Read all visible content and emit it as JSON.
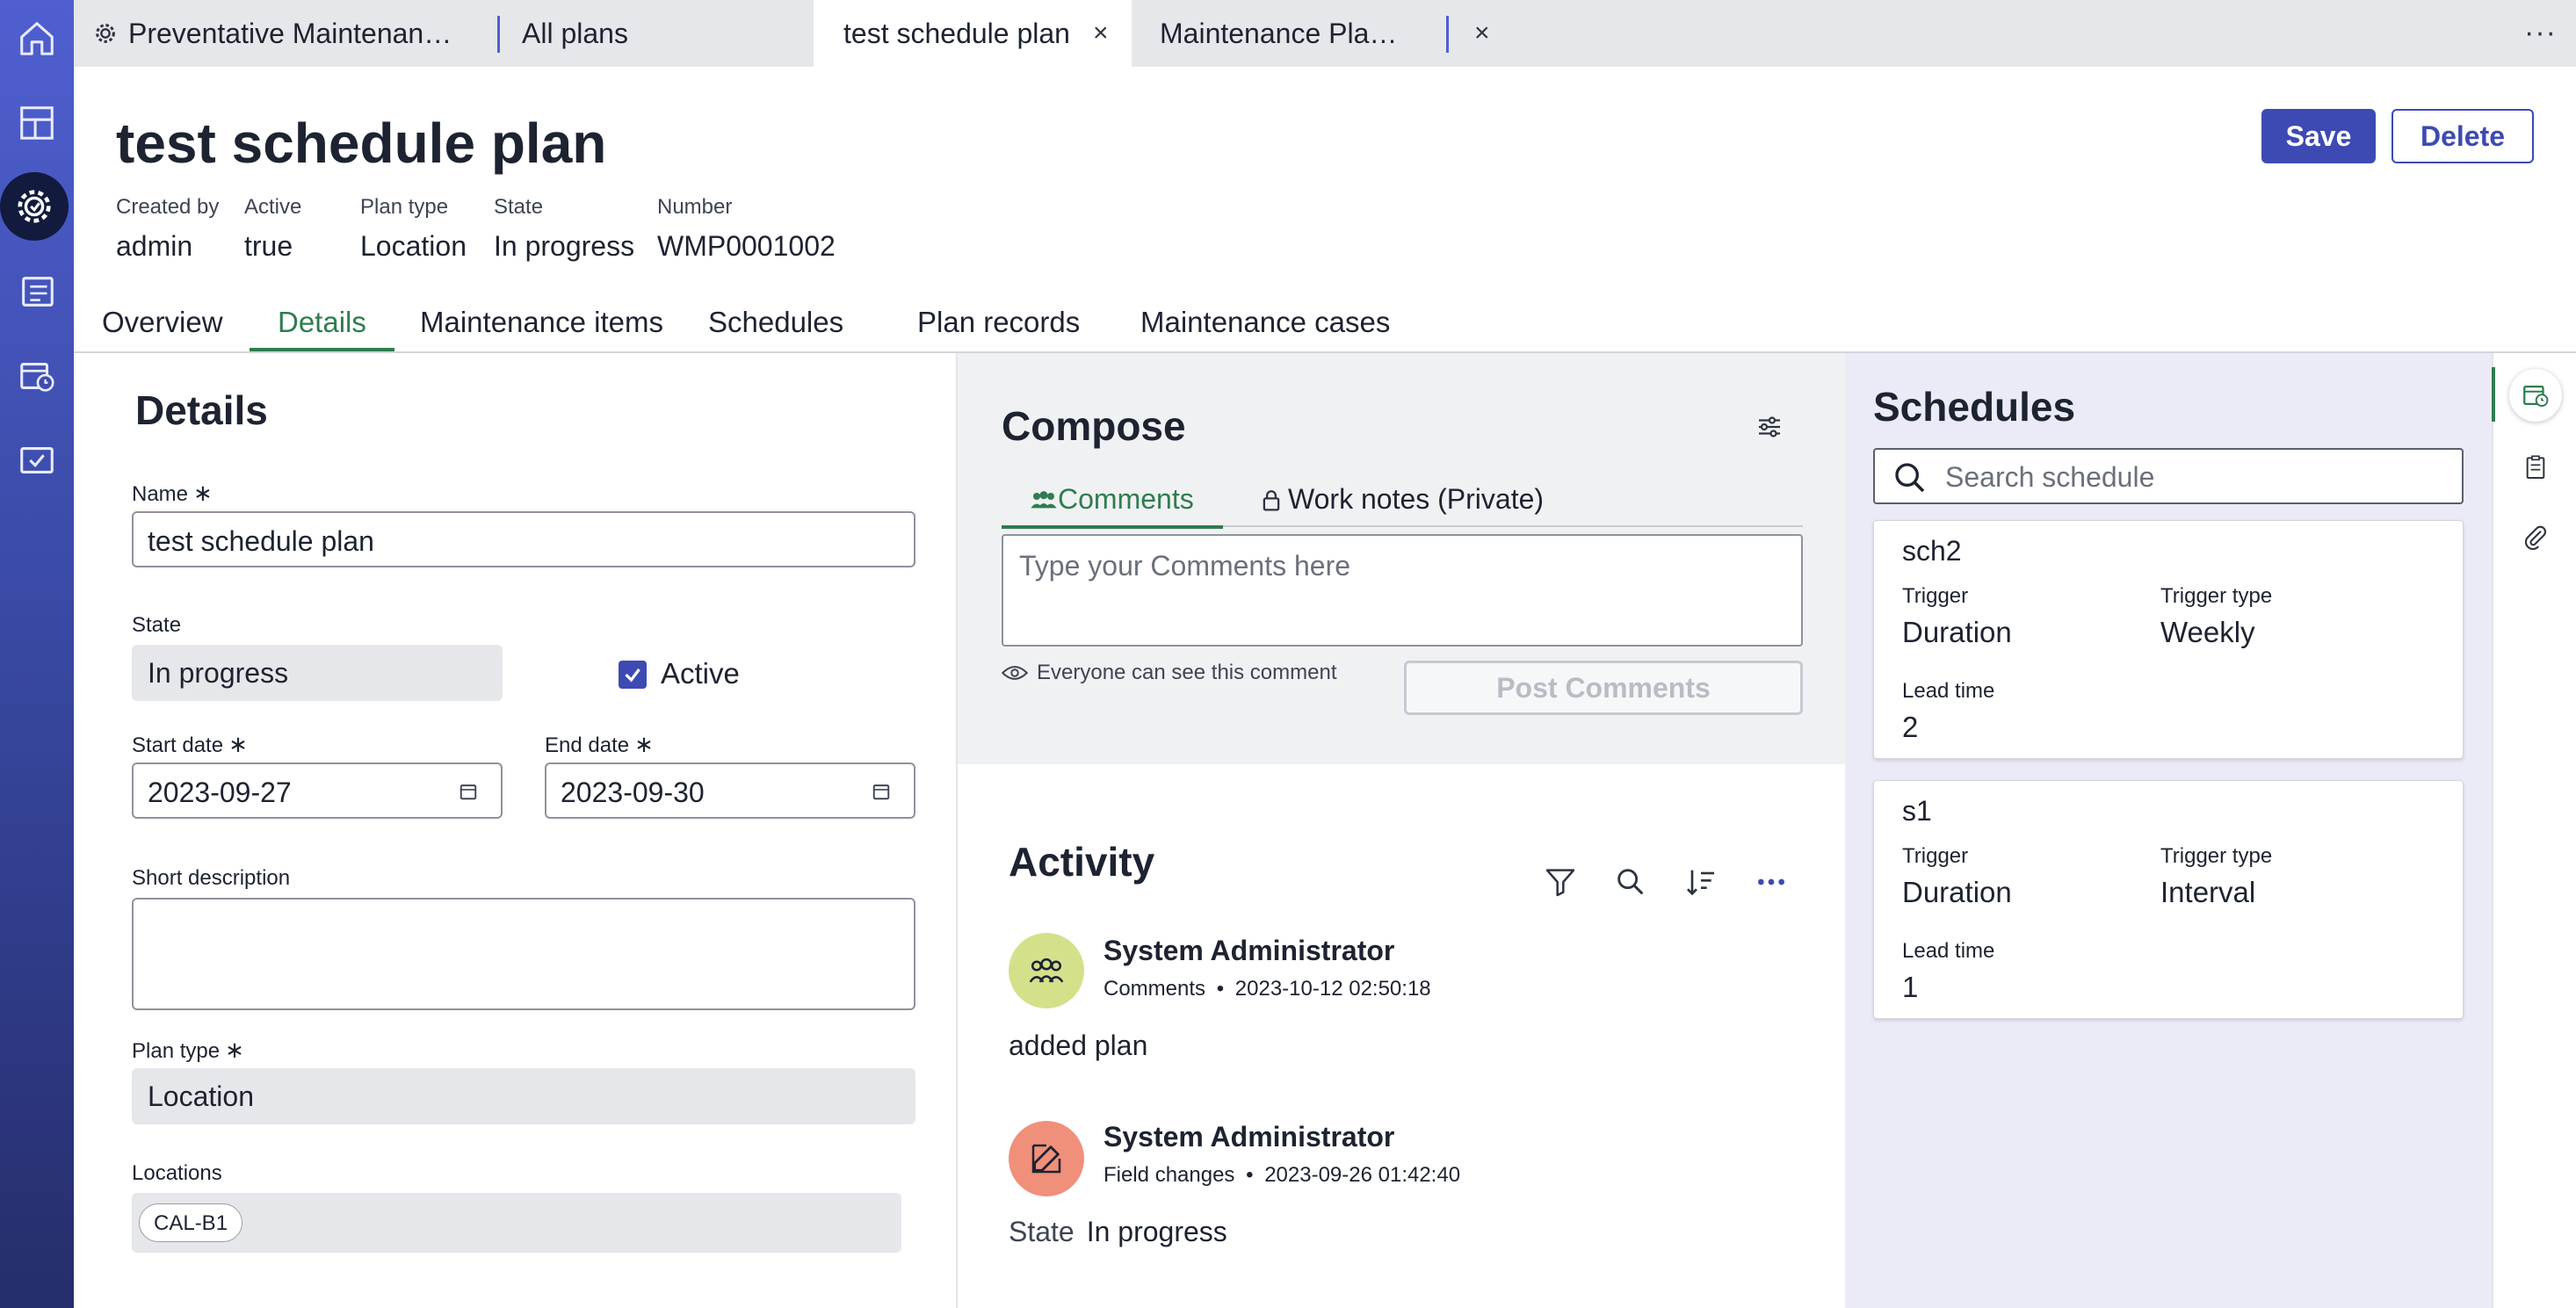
{
  "rail": {
    "items": [
      {
        "icon": "home-icon"
      },
      {
        "icon": "dashboard-icon"
      },
      {
        "icon": "maintenance-gear-icon",
        "active": true
      },
      {
        "icon": "list-icon"
      },
      {
        "icon": "calendar-clock-icon"
      },
      {
        "icon": "checked-board-icon"
      }
    ]
  },
  "tabs": [
    {
      "label": "Preventative Maintenan…",
      "icon": "gear-icon"
    },
    {
      "label": "All plans",
      "close": "×"
    },
    {
      "label": "test schedule plan",
      "close": "×",
      "active": true
    },
    {
      "label": "Maintenance Pla…",
      "close": "×"
    }
  ],
  "tabs_more": "···",
  "header": {
    "title": "test schedule plan",
    "save_label": "Save",
    "delete_label": "Delete",
    "meta": [
      {
        "label": "Created by",
        "value": "admin"
      },
      {
        "label": "Active",
        "value": "true"
      },
      {
        "label": "Plan type",
        "value": "Location"
      },
      {
        "label": "State",
        "value": "In progress"
      },
      {
        "label": "Number",
        "value": "WMP0001002"
      }
    ]
  },
  "page_tabs": [
    "Overview",
    "Details",
    "Maintenance items",
    "Schedules",
    "Plan records",
    "Maintenance cases"
  ],
  "page_tabs_active": "Details",
  "details": {
    "title": "Details",
    "required_mark": "∗",
    "name_label": "Name",
    "name_value": "test schedule plan",
    "state_label": "State",
    "state_value": "In progress",
    "active_label": "Active",
    "active_checked": true,
    "start_label": "Start date",
    "start_value": "2023-09-27",
    "end_label": "End date",
    "end_value": "2023-09-30",
    "short_desc_label": "Short description",
    "short_desc_value": "",
    "plan_type_label": "Plan type",
    "plan_type_value": "Location",
    "locations_label": "Locations",
    "locations": [
      "CAL-B1"
    ]
  },
  "compose": {
    "title": "Compose",
    "tab_comments": "Comments",
    "tab_work_notes": "Work notes (Private)",
    "placeholder": "Type your Comments here",
    "visibility": "Everyone can see this comment",
    "post_label": "Post Comments"
  },
  "activity": {
    "title": "Activity",
    "entries": [
      {
        "author": "System Administrator",
        "type": "Comments",
        "sep": "•",
        "time": "2023-10-12 02:50:18",
        "body": "added plan",
        "avatar_color": "#d5e08a"
      },
      {
        "author": "System Administrator",
        "type": "Field changes",
        "sep": "•",
        "time": "2023-09-26 01:42:40",
        "field": "State",
        "value": "In progress",
        "avatar_color": "#f0907a"
      }
    ]
  },
  "schedules": {
    "title": "Schedules",
    "search_placeholder": "Search schedule",
    "cards": [
      {
        "name": "sch2",
        "trigger_label": "Trigger",
        "trigger": "Duration",
        "trigger_type_label": "Trigger type",
        "trigger_type": "Weekly",
        "lead_label": "Lead time",
        "lead": "2"
      },
      {
        "name": "s1",
        "trigger_label": "Trigger",
        "trigger": "Duration",
        "trigger_type_label": "Trigger type",
        "trigger_type": "Interval",
        "lead_label": "Lead time",
        "lead": "1"
      }
    ]
  },
  "right_strip": {
    "items": [
      {
        "icon": "calendar-clock-icon",
        "active": true
      },
      {
        "icon": "clipboard-icon"
      },
      {
        "icon": "paperclip-icon"
      }
    ]
  },
  "colors": {
    "accent": "#3d4ab3",
    "active_tab": "#2e7d4f",
    "rail_top": "#4f5fd0",
    "rail_bottom": "#262d6b",
    "schedule_panel": "#ebebf7"
  }
}
